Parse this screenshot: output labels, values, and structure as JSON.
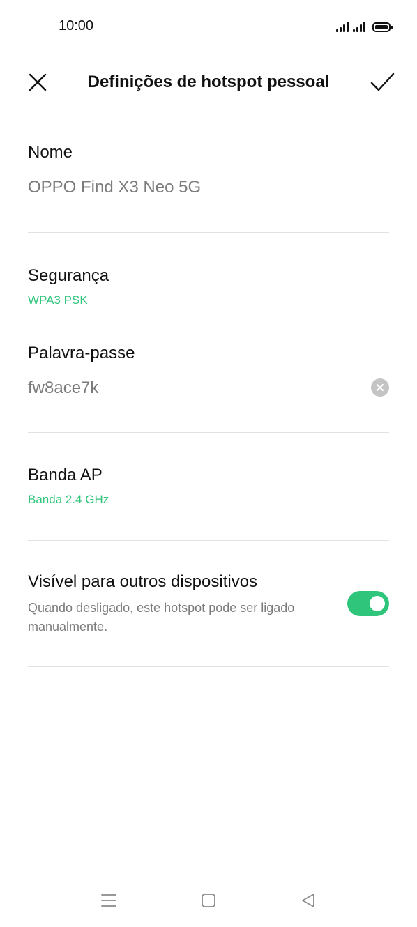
{
  "status_bar": {
    "time": "10:00",
    "icons": [
      "signal-icon",
      "signal-icon",
      "battery-icon"
    ]
  },
  "header": {
    "title": "Definições de hotspot pessoal",
    "close_icon": "close-icon",
    "confirm_icon": "check-icon"
  },
  "name_field": {
    "label": "Nome",
    "value": "OPPO Find X3 Neo 5G"
  },
  "security": {
    "label": "Segurança",
    "value": "WPA3 PSK"
  },
  "password": {
    "label": "Palavra-passe",
    "value": "fw8ace7k",
    "clear_icon": "clear-icon"
  },
  "band": {
    "label": "Banda AP",
    "value": "Banda 2.4 GHz"
  },
  "visibility": {
    "label": "Visível para outros dispositivos",
    "description": "Quando desligado, este hotspot pode ser ligado manualmente.",
    "enabled": true
  },
  "nav_bar": {
    "icons": [
      "menu-icon",
      "home-icon",
      "back-icon"
    ]
  },
  "colors": {
    "accent": "#2fc57a",
    "text": "#111111",
    "secondary_text": "#7b7b7b",
    "divider": "#e2e2e2"
  }
}
